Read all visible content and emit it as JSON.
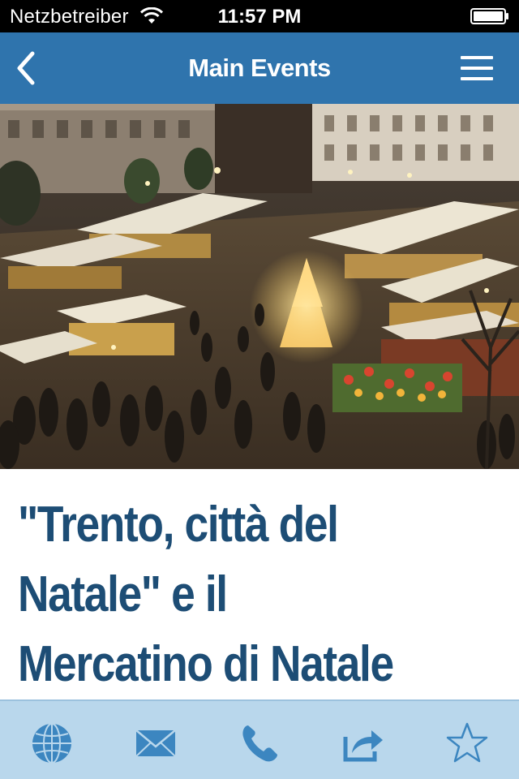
{
  "status_bar": {
    "carrier": "Netzbetreiber",
    "time": "11:57 PM"
  },
  "nav_bar": {
    "title": "Main Events",
    "back_icon": "chevron-left-icon",
    "menu_icon": "hamburger-menu-icon"
  },
  "article": {
    "image_alt": "Christmas market square",
    "title": "\"Trento, città del\nNatale\" e il\nMercatino di Natale"
  },
  "tab_bar": {
    "items": [
      {
        "icon": "globe-icon"
      },
      {
        "icon": "mail-icon"
      },
      {
        "icon": "phone-icon"
      },
      {
        "icon": "share-icon"
      },
      {
        "icon": "star-icon"
      }
    ]
  },
  "colors": {
    "nav_background": "#2f74ad",
    "title_text": "#1d4d75",
    "tab_bar_background": "#b9d7ec",
    "tab_icon": "#3c86c0"
  }
}
